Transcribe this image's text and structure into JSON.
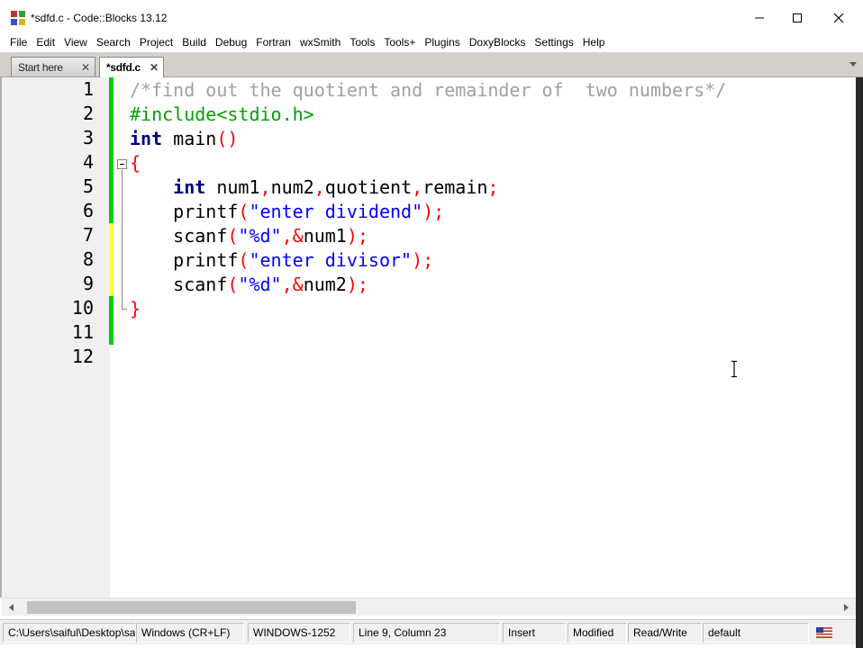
{
  "window": {
    "title": "*sdfd.c - Code::Blocks 13.12"
  },
  "menu": [
    "File",
    "Edit",
    "View",
    "Search",
    "Project",
    "Build",
    "Debug",
    "Fortran",
    "wxSmith",
    "Tools",
    "Tools+",
    "Plugins",
    "DoxyBlocks",
    "Settings",
    "Help"
  ],
  "tabs": [
    {
      "label": "Start here",
      "active": false
    },
    {
      "label": "*sdfd.c",
      "active": true
    }
  ],
  "editor": {
    "line_numbers": [
      "1",
      "2",
      "3",
      "4",
      "5",
      "6",
      "7",
      "8",
      "9",
      "10",
      "11",
      "12"
    ],
    "lines": [
      [
        {
          "t": "/*find out the quotient and remainder of  two numbers*/",
          "c": "comment"
        }
      ],
      [
        {
          "t": "#include<stdio.h>",
          "c": "pre"
        }
      ],
      [
        {
          "t": "int",
          "c": "kw"
        },
        {
          "t": " main",
          "c": "id"
        },
        {
          "t": "()",
          "c": "op"
        }
      ],
      [
        {
          "t": "{",
          "c": "brace"
        }
      ],
      [
        {
          "t": "    ",
          "c": "id"
        },
        {
          "t": "int",
          "c": "kw"
        },
        {
          "t": " num1",
          "c": "id"
        },
        {
          "t": ",",
          "c": "op"
        },
        {
          "t": "num2",
          "c": "id"
        },
        {
          "t": ",",
          "c": "op"
        },
        {
          "t": "quotient",
          "c": "id"
        },
        {
          "t": ",",
          "c": "op"
        },
        {
          "t": "remain",
          "c": "id"
        },
        {
          "t": ";",
          "c": "op"
        }
      ],
      [
        {
          "t": "    printf",
          "c": "id"
        },
        {
          "t": "(",
          "c": "op"
        },
        {
          "t": "\"enter dividend\"",
          "c": "str"
        },
        {
          "t": ");",
          "c": "op"
        }
      ],
      [
        {
          "t": "    scanf",
          "c": "id"
        },
        {
          "t": "(",
          "c": "op"
        },
        {
          "t": "\"%d\"",
          "c": "str"
        },
        {
          "t": ",&",
          "c": "op"
        },
        {
          "t": "num1",
          "c": "id"
        },
        {
          "t": ");",
          "c": "op"
        }
      ],
      [
        {
          "t": "    printf",
          "c": "id"
        },
        {
          "t": "(",
          "c": "op"
        },
        {
          "t": "\"enter divisor\"",
          "c": "str"
        },
        {
          "t": ");",
          "c": "op"
        }
      ],
      [
        {
          "t": "    scanf",
          "c": "id"
        },
        {
          "t": "(",
          "c": "op"
        },
        {
          "t": "\"%d\"",
          "c": "str"
        },
        {
          "t": ",&",
          "c": "op"
        },
        {
          "t": "num2",
          "c": "id"
        },
        {
          "t": ");",
          "c": "op"
        }
      ],
      [
        {
          "t": "}",
          "c": "brace"
        }
      ],
      [],
      []
    ],
    "change_markers": [
      "saved",
      "saved",
      "saved",
      "saved",
      "saved",
      "saved",
      "modified",
      "modified",
      "modified",
      "saved",
      "saved",
      "none"
    ]
  },
  "statusbar": {
    "path": "C:\\Users\\saiful\\Desktop\\sai",
    "eol": "Windows (CR+LF)",
    "encoding": "WINDOWS-1252",
    "position": "Line 9, Column 23",
    "mode": "Insert",
    "modified": "Modified",
    "access": "Read/Write",
    "profile": "default"
  },
  "colors": {
    "comment": "#a0a0a0",
    "preprocessor": "#00a000",
    "keyword": "#000080",
    "string": "#0000ff",
    "operator": "#ff0000",
    "saved_marker": "#00d000",
    "modified_marker": "#ffff40"
  }
}
